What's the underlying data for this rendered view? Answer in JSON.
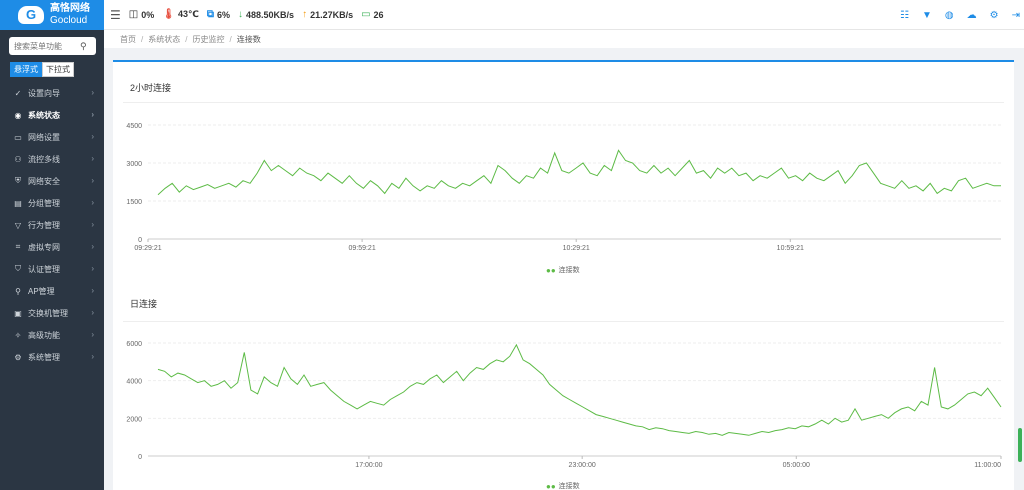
{
  "brand": {
    "name_cn": "高恪网络",
    "name_en": "Gocloud"
  },
  "sidebar": {
    "search_placeholder": "搜索菜单功能",
    "modes": [
      "悬浮式",
      "下拉式"
    ],
    "items": [
      {
        "icon": "✓",
        "icon_name": "compass-icon",
        "label": "设置向导"
      },
      {
        "icon": "◉",
        "icon_name": "status-icon",
        "label": "系统状态",
        "active": true
      },
      {
        "icon": "▭",
        "icon_name": "monitor-icon",
        "label": "网络设置"
      },
      {
        "icon": "⚇",
        "icon_name": "flow-icon",
        "label": "流控多线"
      },
      {
        "icon": "⛨",
        "icon_name": "shield-icon",
        "label": "网络安全"
      },
      {
        "icon": "▤",
        "icon_name": "group-icon",
        "label": "分组管理"
      },
      {
        "icon": "▽",
        "icon_name": "filter-icon",
        "label": "行为管理"
      },
      {
        "icon": "⌗",
        "icon_name": "vpn-icon",
        "label": "虚拟专网"
      },
      {
        "icon": "⛉",
        "icon_name": "cert-icon",
        "label": "认证管理"
      },
      {
        "icon": "⚲",
        "icon_name": "ap-icon",
        "label": "AP管理"
      },
      {
        "icon": "▣",
        "icon_name": "switch-icon",
        "label": "交换机管理"
      },
      {
        "icon": "✧",
        "icon_name": "advanced-icon",
        "label": "高级功能"
      },
      {
        "icon": "⚙",
        "icon_name": "gear-icon",
        "label": "系统管理"
      }
    ]
  },
  "topbar": {
    "cpu": "0%",
    "temp": "43℃",
    "mem": "6%",
    "down": "488.50KB/s",
    "up": "21.27KB/s",
    "terminals": "26",
    "colors": {
      "temp": "#e74c3c",
      "mem": "#1e8ce6",
      "down": "#3db158",
      "up": "#f39c12",
      "term": "#3db158"
    }
  },
  "breadcrumb": [
    "首页",
    "系统状态",
    "历史监控",
    "连接数"
  ],
  "chart_data": [
    {
      "type": "line",
      "title": "2小时连接",
      "legend": "连接数",
      "series_color": "#5dbb46",
      "ylim": [
        0,
        4500
      ],
      "yticks": [
        0,
        1500,
        3000,
        4500
      ],
      "xticks": [
        "09:29:21",
        "09:59:21",
        "10:29:21",
        "10:59:21"
      ],
      "xrange_minutes": [
        0,
        120
      ],
      "series": [
        {
          "name": "连接数",
          "values": [
            1750,
            2000,
            2200,
            1850,
            2100,
            1950,
            2050,
            2150,
            2000,
            2100,
            2200,
            2050,
            2300,
            2200,
            2600,
            3100,
            2700,
            2900,
            2700,
            2500,
            2800,
            2600,
            2500,
            2300,
            2600,
            2400,
            2200,
            2500,
            2200,
            2000,
            2300,
            2100,
            1800,
            2200,
            2000,
            2400,
            2100,
            1900,
            2100,
            2000,
            2300,
            2100,
            2000,
            2200,
            2100,
            2300,
            2500,
            2200,
            2900,
            2700,
            2400,
            2200,
            2500,
            2400,
            2800,
            2600,
            3400,
            2700,
            2600,
            2800,
            3000,
            2600,
            2500,
            2900,
            2700,
            3500,
            3100,
            3000,
            2700,
            2600,
            2900,
            2600,
            2800,
            2500,
            2800,
            3100,
            2600,
            2700,
            2400,
            2800,
            2600,
            2800,
            2500,
            2600,
            2300,
            2500,
            2400,
            2600,
            2800,
            2400,
            2500,
            2300,
            2600,
            2400,
            2300,
            2500,
            2700,
            2200,
            2500,
            2900,
            3000,
            2600,
            2200,
            2100,
            2000,
            2300,
            2000,
            2100,
            1900,
            2200,
            1800,
            2000,
            1900,
            2300,
            2400,
            2000,
            2100,
            2200,
            2100,
            2100
          ]
        }
      ]
    },
    {
      "type": "line",
      "title": "日连接",
      "legend": "连接数",
      "series_color": "#5dbb46",
      "ylim": [
        0,
        6000
      ],
      "yticks": [
        0,
        2000,
        4000,
        6000
      ],
      "xticks": [
        "17:00:00",
        "23:00:00",
        "05:00:00",
        "11:00:00"
      ],
      "xrange_hours": [
        11.5,
        35
      ],
      "series": [
        {
          "name": "连接数",
          "values": [
            4600,
            4500,
            4200,
            4400,
            4300,
            4100,
            3900,
            4000,
            3700,
            3800,
            4000,
            3600,
            3900,
            5500,
            3500,
            3300,
            4200,
            3900,
            3700,
            4700,
            4100,
            3800,
            4300,
            3700,
            3800,
            3900,
            3500,
            3200,
            2900,
            2700,
            2500,
            2700,
            2900,
            2800,
            2700,
            3000,
            3200,
            3400,
            3700,
            3900,
            3800,
            4100,
            4300,
            3900,
            4200,
            4500,
            4000,
            4400,
            4700,
            4600,
            4900,
            5100,
            5000,
            5300,
            5900,
            5100,
            4900,
            4600,
            4300,
            3800,
            3500,
            3200,
            3000,
            2800,
            2600,
            2400,
            2200,
            2100,
            2000,
            1900,
            1800,
            1700,
            1600,
            1550,
            1400,
            1500,
            1450,
            1350,
            1300,
            1250,
            1200,
            1300,
            1250,
            1150,
            1200,
            1100,
            1250,
            1200,
            1150,
            1100,
            1200,
            1300,
            1250,
            1350,
            1400,
            1500,
            1450,
            1600,
            1550,
            1700,
            1900,
            1700,
            2000,
            1800,
            1900,
            2500,
            1900,
            2000,
            2100,
            2200,
            2000,
            2300,
            2500,
            2600,
            2400,
            2900,
            2700,
            4700,
            2600,
            2500,
            2700,
            3000,
            3300,
            3400,
            3200,
            3600,
            3100,
            2600
          ]
        }
      ]
    }
  ]
}
